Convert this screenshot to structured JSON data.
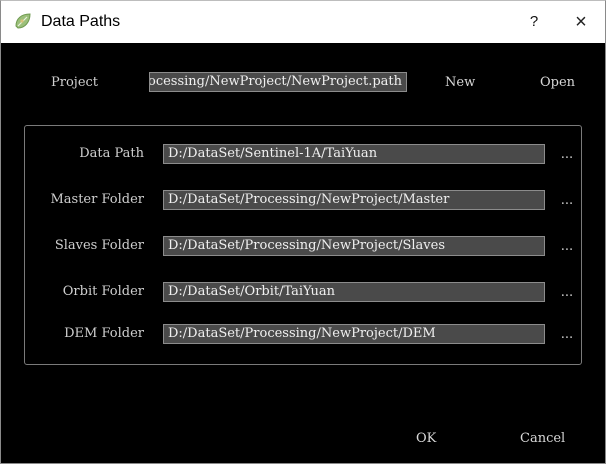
{
  "window": {
    "title": "Data Paths",
    "help_label": "?",
    "close_label": "×"
  },
  "project": {
    "label": "Project",
    "value": "D:/DataSet/Processing/NewProject/NewProject.path",
    "new_label": "New",
    "open_label": "Open"
  },
  "paths": {
    "data_path": {
      "label": "Data Path",
      "value": "D:/DataSet/Sentinel-1A/TaiYuan",
      "browse": "..."
    },
    "master_folder": {
      "label": "Master Folder",
      "value": "D:/DataSet/Processing/NewProject/Master",
      "browse": "..."
    },
    "slaves_folder": {
      "label": "Slaves Folder",
      "value": "D:/DataSet/Processing/NewProject/Slaves",
      "browse": "..."
    },
    "orbit_folder": {
      "label": "Orbit Folder",
      "value": "D:/DataSet/Orbit/TaiYuan",
      "browse": "..."
    },
    "dem_folder": {
      "label": "DEM Folder",
      "value": "D:/DataSet/Processing/NewProject/DEM",
      "browse": "..."
    }
  },
  "footer": {
    "ok_label": "OK",
    "cancel_label": "Cancel"
  },
  "icons": {
    "app": "leaf-map-icon"
  }
}
